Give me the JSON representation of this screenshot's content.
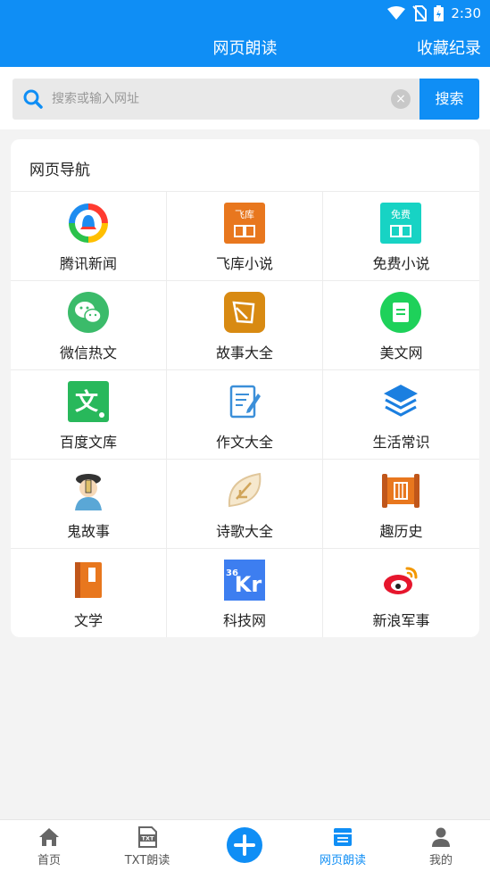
{
  "status_bar": {
    "time": "2:30",
    "icons": [
      "wifi-icon",
      "no-sim-icon",
      "battery-charging-icon"
    ]
  },
  "app_bar": {
    "title": "网页朗读",
    "action_label": "收藏纪录"
  },
  "search": {
    "placeholder": "搜索或输入网址",
    "value": "",
    "button_label": "搜索"
  },
  "nav_card": {
    "title": "网页导航",
    "items": [
      {
        "label": "腾讯新闻",
        "icon": "tencent-news-icon"
      },
      {
        "label": "飞库小说",
        "icon": "feiku-novel-icon",
        "icon_text": "飞库"
      },
      {
        "label": "免费小说",
        "icon": "free-novel-icon",
        "icon_text": "免费"
      },
      {
        "label": "微信热文",
        "icon": "wechat-icon"
      },
      {
        "label": "故事大全",
        "icon": "story-collection-icon"
      },
      {
        "label": "美文网",
        "icon": "meiwen-icon"
      },
      {
        "label": "百度文库",
        "icon": "baidu-wenku-icon",
        "icon_text": "文"
      },
      {
        "label": "作文大全",
        "icon": "essay-edit-icon"
      },
      {
        "label": "生活常识",
        "icon": "layers-icon"
      },
      {
        "label": "鬼故事",
        "icon": "ghost-story-icon"
      },
      {
        "label": "诗歌大全",
        "icon": "poetry-icon"
      },
      {
        "label": "趣历史",
        "icon": "history-scroll-icon"
      },
      {
        "label": "文学",
        "icon": "literature-book-icon"
      },
      {
        "label": "科技网",
        "icon": "36kr-icon",
        "icon_text": "Kr",
        "icon_small_text": "36"
      },
      {
        "label": "新浪军事",
        "icon": "weibo-icon"
      }
    ]
  },
  "tab_bar": {
    "items": [
      {
        "label": "首页",
        "icon": "home-icon",
        "active": false
      },
      {
        "label": "TXT朗读",
        "icon": "txt-file-icon",
        "icon_text": "TXT",
        "active": false
      },
      {
        "label": "",
        "icon": "add-icon",
        "active": false
      },
      {
        "label": "网页朗读",
        "icon": "webpage-icon",
        "active": true
      },
      {
        "label": "我的",
        "icon": "profile-icon",
        "active": false
      }
    ]
  },
  "colors": {
    "primary": "#0f8ef5",
    "background": "#f3f3f3"
  }
}
